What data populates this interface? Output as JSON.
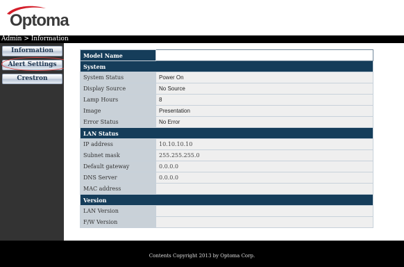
{
  "brand": {
    "logo_text": "Optoma"
  },
  "breadcrumb": "Admin > Information",
  "nav": [
    {
      "label": "Information"
    },
    {
      "label": "Alert Settings"
    },
    {
      "label": "Crestron"
    }
  ],
  "table": {
    "model_name_label": "Model Name",
    "sections": [
      {
        "title": "System",
        "rows": [
          {
            "label": "System Status",
            "value": "Power On"
          },
          {
            "label": "Display Source",
            "value": "No Source"
          },
          {
            "label": "Lamp Hours",
            "value": "8"
          },
          {
            "label": "Image",
            "value": "Presentation"
          },
          {
            "label": "Error Status",
            "value": "No Error"
          }
        ]
      },
      {
        "title": "LAN Status",
        "rows": [
          {
            "label": "IP address",
            "value": "10.10.10.10"
          },
          {
            "label": "Subnet mask",
            "value": "255.255.255.0"
          },
          {
            "label": "Default gateway",
            "value": "0.0.0.0"
          },
          {
            "label": "DNS Server",
            "value": "0.0.0.0"
          },
          {
            "label": "MAC address",
            "value": ""
          }
        ]
      },
      {
        "title": "Version",
        "rows": [
          {
            "label": "LAN Version",
            "value": ""
          },
          {
            "label": "F/W Version",
            "value": ""
          }
        ]
      }
    ]
  },
  "footer": {
    "text": "Contents Copyright 2013 by Optoma Corp."
  },
  "colors": {
    "header_bg": "#153d5a",
    "label_bg": "#c9d1d8",
    "value_bg": "#efefef",
    "logo_red": "#d41e2a"
  }
}
